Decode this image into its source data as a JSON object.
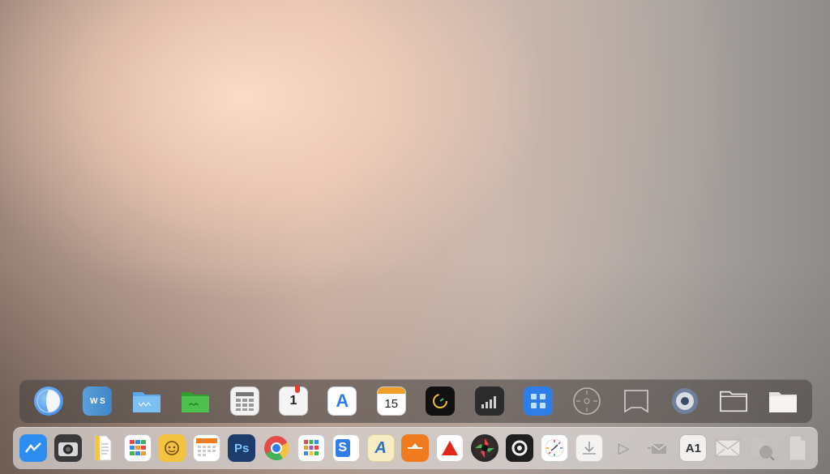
{
  "desktop": {
    "upper_dock": [
      {
        "id": "finder-icon"
      },
      {
        "id": "files-icon",
        "label": "W S"
      },
      {
        "id": "blue-folder-icon"
      },
      {
        "id": "green-folder-icon"
      },
      {
        "id": "calculator-icon"
      },
      {
        "id": "notification-calendar-icon",
        "label": "1"
      },
      {
        "id": "app-store-icon",
        "label": "A"
      },
      {
        "id": "calendar-icon",
        "label": "15"
      },
      {
        "id": "clock-app-icon"
      },
      {
        "id": "activity-monitor-icon"
      },
      {
        "id": "apps-grid-icon"
      },
      {
        "id": "compass-icon"
      },
      {
        "id": "window-frame-icon"
      },
      {
        "id": "disk-utility-icon"
      },
      {
        "id": "folder-outline-icon"
      },
      {
        "id": "white-folder-icon"
      }
    ],
    "lower_dock": [
      {
        "id": "messenger-icon"
      },
      {
        "id": "camera-icon"
      },
      {
        "id": "document-icon"
      },
      {
        "id": "spreadsheet-icon"
      },
      {
        "id": "support-icon"
      },
      {
        "id": "calendar-grid-icon"
      },
      {
        "id": "photoshop-icon",
        "label": "Ps"
      },
      {
        "id": "chrome-icon"
      },
      {
        "id": "color-grid-icon"
      },
      {
        "id": "skype-doc-icon",
        "label": "S"
      },
      {
        "id": "font-app-icon",
        "label": "A"
      },
      {
        "id": "orange-app-icon"
      },
      {
        "id": "warning-app-icon"
      },
      {
        "id": "media-app-icon"
      },
      {
        "id": "ring-app-icon"
      },
      {
        "id": "clock-icon"
      },
      {
        "id": "download-icon"
      },
      {
        "id": "play-arrow-icon",
        "label": "▷"
      },
      {
        "id": "mail-sm-icon"
      },
      {
        "id": "font-book-icon",
        "label": "A1"
      },
      {
        "id": "mail-icon"
      },
      {
        "id": "preview-icon"
      },
      {
        "id": "document-blank-icon"
      }
    ]
  },
  "colors": {
    "accent_blue": "#2f7ee8",
    "photoshop": "#1d3c6b",
    "orange": "#f07b1f",
    "green": "#3fbf3f"
  }
}
